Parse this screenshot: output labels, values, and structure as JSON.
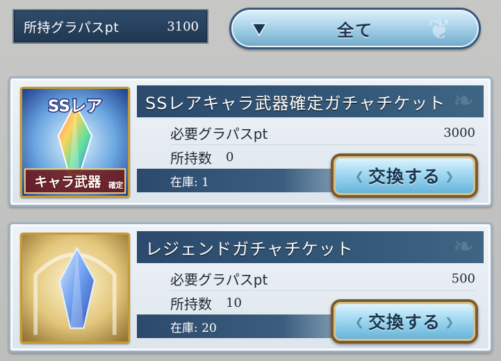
{
  "header": {
    "points_label": "所持グラパスpt",
    "points_value": "3100",
    "filter_label": "全て"
  },
  "items": [
    {
      "title": "SSレアキャラ武器確定ガチャチケット",
      "cost_label": "必要グラパスpt",
      "cost_value": "3000",
      "owned_label": "所持数",
      "owned_value": "0",
      "stock_text": "在庫: 1",
      "button_label": "交換する",
      "thumb": {
        "top_text": "SSレア",
        "bottom_text": "キャラ武器",
        "bottom_small": "確定"
      }
    },
    {
      "title": "レジェンドガチャチケット",
      "cost_label": "必要グラパスpt",
      "cost_value": "500",
      "owned_label": "所持数",
      "owned_value": "10",
      "stock_text": "在庫: 20",
      "button_label": "交換する"
    }
  ],
  "icons": {
    "filter_arrow": "triangle-down-icon",
    "item1_thumb": "ss-rare-crystal-icon",
    "item2_thumb": "legend-crystal-icon"
  },
  "colors": {
    "panel_navy": "#2b4a6d",
    "button_blue": "#a8dcf3",
    "frame_gold": "#c69a2e"
  }
}
